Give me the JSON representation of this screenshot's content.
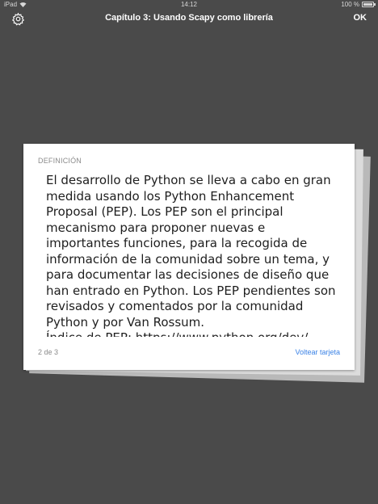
{
  "status_bar": {
    "carrier": "iPad",
    "time": "14:12",
    "battery": "100 %"
  },
  "nav": {
    "title": "Capítulo 3: Usando Scapy como librería",
    "ok_label": "OK",
    "settings_icon": "gear-icon"
  },
  "card": {
    "label": "DEFINICIÓN",
    "paragraph_1": "El desarrollo de Python se lleva a cabo en gran medida usando los Python Enhancement Proposal (PEP). Los PEP son el principal mecanismo para proponer nuevas e importantes funciones, para la recogida de información de la comunidad sobre un tema, y para documentar las decisiones de diseño que han entrado en Python. Los PEP pendientes son revisados y comentados por la comunidad Python y por Van Rossum.",
    "paragraph_2": "Índice de PEP: https://www.python.org/dev/",
    "page_indicator": "2 de 3",
    "flip_label": "Voltear tarjeta"
  },
  "colors": {
    "background": "#4a4a4a",
    "card": "#ffffff",
    "link": "#3a82e6",
    "muted_text": "#8a8a8a"
  }
}
